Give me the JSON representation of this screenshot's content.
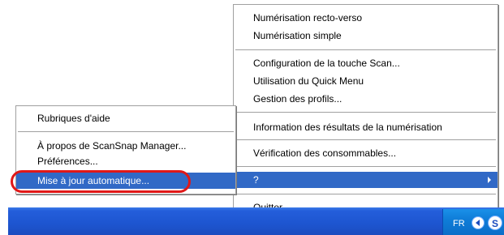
{
  "main_menu": {
    "duplex_scan": "Numérisation recto-verso",
    "simplex_scan": "Numérisation simple",
    "scan_button_config": "Configuration de la touche Scan...",
    "quick_menu": "Utilisation du Quick Menu",
    "profile_management": "Gestion des profils...",
    "scan_results_info": "Information des résultats de la numérisation",
    "consumables_check": "Vérification des consommables...",
    "help": "?",
    "quit": "Quitter"
  },
  "help_submenu": {
    "help_topics": "Rubriques d'aide",
    "about": "À propos de ScanSnap Manager...",
    "preferences": "Préférences...",
    "auto_update": "Mise à jour automatique..."
  },
  "taskbar": {
    "language": "FR",
    "tray_icon": "S"
  },
  "colors": {
    "highlight": "#3169c6",
    "taskbar": "#245edb",
    "callout_ring": "#e01818"
  }
}
